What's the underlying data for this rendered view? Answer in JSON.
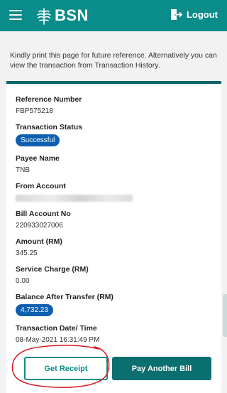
{
  "header": {
    "brand": "BSN",
    "logout_label": "Logout"
  },
  "notice": "Kindly print this page for future reference. Alternatively you can view the transaction from Transaction History.",
  "receipt": {
    "reference_label": "Reference Number",
    "reference_value": "FBP575218",
    "status_label": "Transaction Status",
    "status_value": "Successful",
    "payee_label": "Payee Name",
    "payee_value": "TNB",
    "from_label": "From Account",
    "bill_account_label": "Bill Account No",
    "bill_account_value": "220933027006",
    "amount_label": "Amount (RM)",
    "amount_value": "345.25",
    "service_label": "Service Charge (RM)",
    "service_value": "0.00",
    "balance_label": "Balance After Transfer (RM)",
    "balance_value": "4,732.23",
    "datetime_label": "Transaction Date/ Time",
    "datetime_value": "08-May-2021 16:31:49 PM"
  },
  "actions": {
    "get_receipt": "Get Receipt",
    "pay_another": "Pay Another Bill"
  },
  "colors": {
    "header": "#0a8c8a",
    "pill": "#0e5fb0",
    "button_dark": "#0b6f6f",
    "annotation": "#d81f26"
  }
}
